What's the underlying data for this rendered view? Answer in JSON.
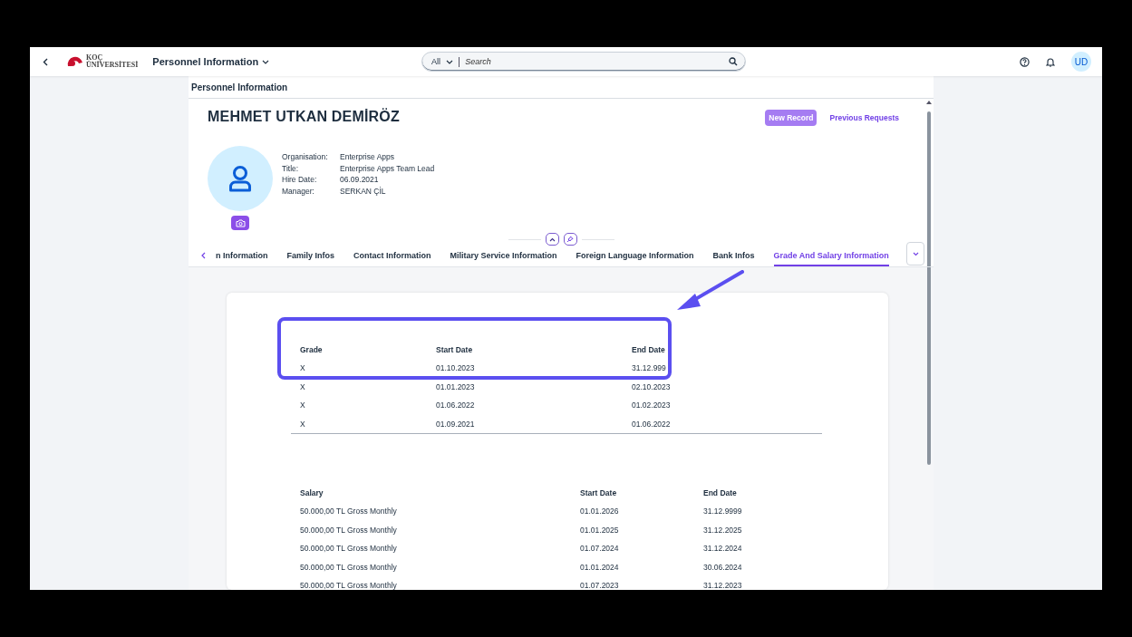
{
  "shell": {
    "logo_text": [
      "KOÇ",
      "ÜNİVERSİTESİ"
    ],
    "title": "Personnel Information",
    "search": {
      "scope": "All",
      "placeholder": "Search"
    },
    "user_initials": "UD"
  },
  "page": {
    "title": "Personnel Information"
  },
  "employee": {
    "name": "MEHMET UTKAN DEMİRÖZ",
    "fields": [
      {
        "label": "Organisation:",
        "value": "Enterprise Apps"
      },
      {
        "label": "Title:",
        "value": "Enterprise Apps Team Lead"
      },
      {
        "label": "Hire Date:",
        "value": "06.09.2021"
      },
      {
        "label": "Manager:",
        "value": "SERKAN ÇİL"
      }
    ]
  },
  "actions": [
    {
      "label": "New Record",
      "disabled": true
    },
    {
      "label": "Previous Requests",
      "disabled": false
    }
  ],
  "tabs": [
    {
      "label": "n Information",
      "selected": false
    },
    {
      "label": "Family Infos",
      "selected": false
    },
    {
      "label": "Contact Information",
      "selected": false
    },
    {
      "label": "Military Service Information",
      "selected": false
    },
    {
      "label": "Foreign Language Information",
      "selected": false
    },
    {
      "label": "Bank Infos",
      "selected": false
    },
    {
      "label": "Grade And Salary Information",
      "selected": true
    }
  ],
  "grade_table": {
    "columns": [
      "Grade",
      "Start Date",
      "End Date"
    ],
    "rows": [
      [
        "X",
        "01.10.2023",
        "31.12.999"
      ],
      [
        "X",
        "01.01.2023",
        "02.10.2023"
      ],
      [
        "X",
        "01.06.2022",
        "01.02.2023"
      ],
      [
        "X",
        "01.09.2021",
        "01.06.2022"
      ]
    ]
  },
  "salary_table": {
    "columns": [
      "Salary",
      "Start Date",
      "End Date"
    ],
    "rows": [
      [
        "50.000,00 TL Gross Monthly",
        "01.01.2026",
        "31.12.9999"
      ],
      [
        "50.000,00 TL Gross Monthly",
        "01.01.2025",
        "31.12.2025"
      ],
      [
        "50.000,00 TL Gross Monthly",
        "01.07.2024",
        "31.12.2024"
      ],
      [
        "50.000,00 TL Gross Monthly",
        "01.01.2024",
        "30.06.2024"
      ],
      [
        "50.000,00 TL Gross Monthly",
        "01.07.2023",
        "31.12.2023"
      ]
    ]
  }
}
